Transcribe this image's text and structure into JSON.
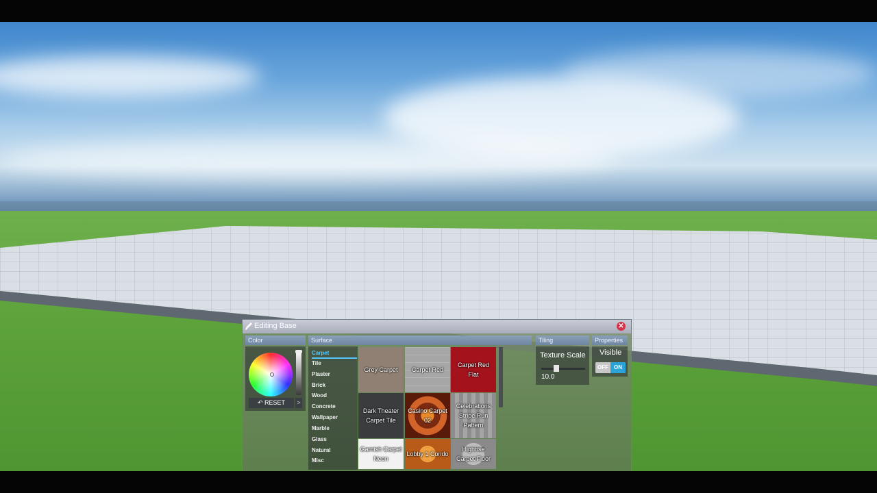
{
  "window": {
    "title": "Editing Base"
  },
  "sections": {
    "color": "Color",
    "surface": "Surface",
    "tiling": "Tiling",
    "properties": "Properties"
  },
  "color_panel": {
    "reset_label": "RESET",
    "next_label": ">"
  },
  "categories": [
    "Carpet",
    "Tile",
    "Plaster",
    "Brick",
    "Wood",
    "Concrete",
    "Wallpaper",
    "Marble",
    "Glass",
    "Natural",
    "Misc"
  ],
  "active_category": "Carpet",
  "materials": [
    {
      "label": "Grey Carpet",
      "color": "#8f8073"
    },
    {
      "label": "Carpet Red",
      "color": "#a6a6a6"
    },
    {
      "label": "Carpet Red Flat",
      "color": "#a4121c"
    },
    {
      "label": "Dark Theater Carpet Tile",
      "color": "#3b3c3e"
    },
    {
      "label": "Casino Carpet 02",
      "color": "#c2541a"
    },
    {
      "label": "Celebrations Stripe Run Pattern",
      "color": "#8d8d8d"
    },
    {
      "label": "Garnish Carpet Neon",
      "color": "#f2f2f2"
    },
    {
      "label": "Lobby 1 Condo",
      "color": "#e0781e"
    },
    {
      "label": "Highrise Carpet Floor",
      "color": "#9a9a9a"
    }
  ],
  "tiling": {
    "label": "Texture Scale",
    "value": "10.0",
    "level": 0.3
  },
  "properties": {
    "visible_label": "Visible",
    "off_label": "OFF",
    "on_label": "ON",
    "state": "ON"
  },
  "colors": {
    "accent": "#56c8ff",
    "close": "#d9304a",
    "toggle_on": "#2aa4d8"
  },
  "icons": {
    "title": "brush-icon",
    "close": "close-icon",
    "reset": "undo-icon"
  }
}
